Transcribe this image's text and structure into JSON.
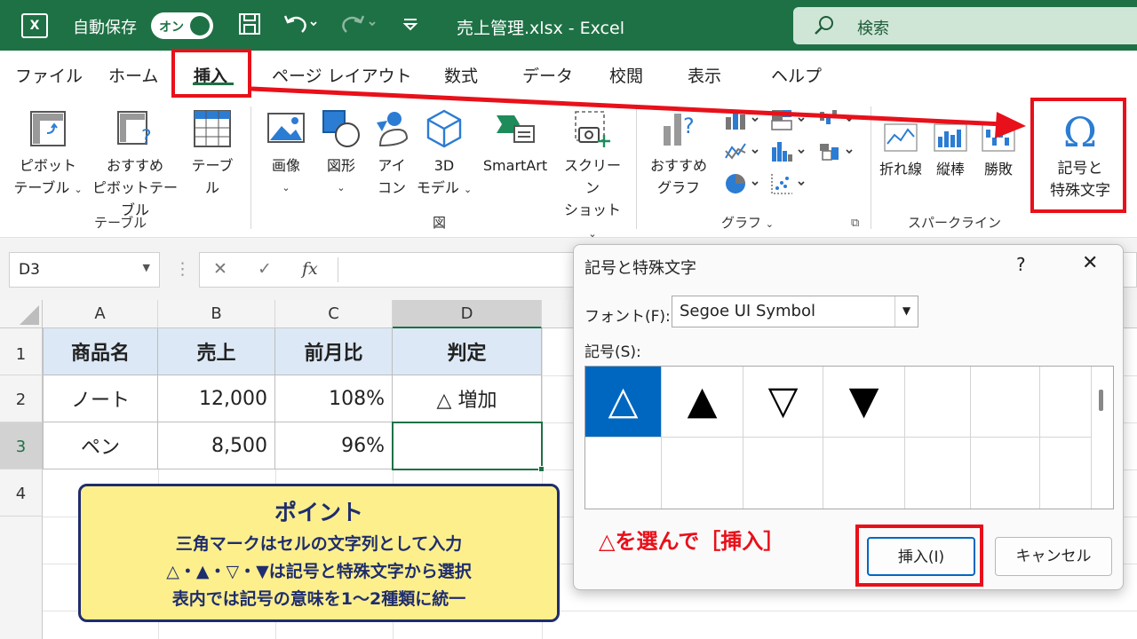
{
  "titlebar": {
    "app_icon": "X",
    "autosave_label": "自動保存",
    "toggle_label": "オン",
    "filename": "売上管理.xlsx  -  Excel",
    "search_placeholder": "検索"
  },
  "tabs": [
    "ファイル",
    "ホーム",
    "挿入",
    "ページ レイアウト",
    "数式",
    "データ",
    "校閲",
    "表示",
    "ヘルプ"
  ],
  "active_tab": "挿入",
  "ribbon": {
    "pivot": [
      "ピボット",
      "テーブル"
    ],
    "recommended_pivot": [
      "おすすめ",
      "ピボットテーブル"
    ],
    "table": "テーブル",
    "group_table": "テーブル",
    "picture": "画像",
    "shapes": "図形",
    "icons": [
      "アイ",
      "コン"
    ],
    "model3d": [
      "3D",
      "モデル"
    ],
    "smartart": "SmartArt",
    "screenshot": [
      "スクリーン",
      "ショット"
    ],
    "group_illustrations": "図",
    "recommended_charts": [
      "おすすめ",
      "グラフ"
    ],
    "group_charts": "グラフ",
    "sparkline_line": "折れ線",
    "sparkline_column": "縦棒",
    "sparkline_winloss": "勝敗",
    "group_sparklines": "スパークライン",
    "symbol": [
      "記号と",
      "特殊文字"
    ],
    "symbol_glyph": "Ω"
  },
  "formula_bar": {
    "name_box": "D3",
    "cancel": "✕",
    "enter": "✓",
    "fx": "fx",
    "content": ""
  },
  "sheet": {
    "columns": [
      "A",
      "B",
      "C",
      "D"
    ],
    "rows": [
      "1",
      "2",
      "3",
      "4"
    ],
    "header_row": [
      "商品名",
      "売上",
      "前月比",
      "判定"
    ],
    "data_rows": [
      [
        "ノート",
        "12,000",
        "108%",
        "△ 増加"
      ],
      [
        "ペン",
        "8,500",
        "96%",
        ""
      ]
    ],
    "active_cell": "D3"
  },
  "point_box": {
    "title": "ポイント",
    "lines": [
      "三角マークはセルの文字列として入力",
      "△・▲・▽・▼は記号と特殊文字から選択",
      "表内では記号の意味を1～2種類に統一"
    ]
  },
  "dialog": {
    "title": "記号と特殊文字",
    "help": "?",
    "close": "✕",
    "font_label": "フォント(F):",
    "font_value": "Segoe UI Symbol",
    "symbols_label": "記号(S):",
    "symbols": [
      "△",
      "▲",
      "▽",
      "▼"
    ],
    "selected_symbol": "△",
    "annotation": "△を選んで［挿入］",
    "insert_button": "挿入(I)",
    "cancel_button": "キャンセル"
  },
  "colors": {
    "excel_green": "#1e7145",
    "highlight_red": "#e8101a",
    "selection_blue": "#0067c0",
    "header_fill": "#dce8f5",
    "point_fill": "#fdf08c"
  }
}
